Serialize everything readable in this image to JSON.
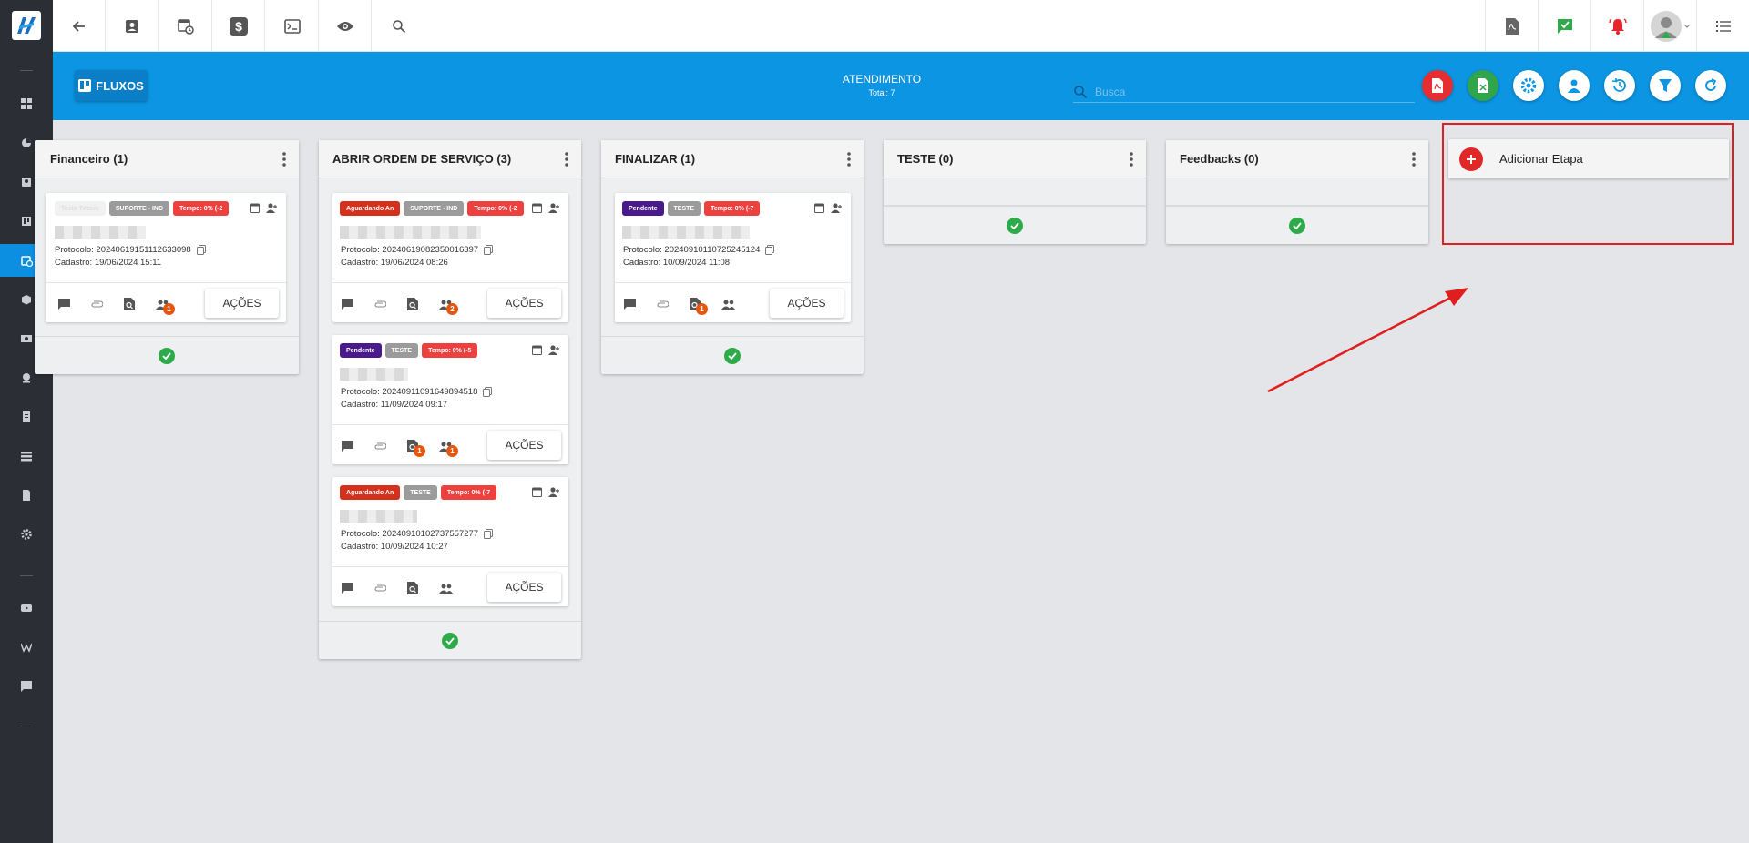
{
  "header": {
    "app_label": "FLUXOS",
    "title": "ATENDIMENTO",
    "total": "Total: 7",
    "search_placeholder": "Busca"
  },
  "colors": {
    "header_blue": "#0c95e3",
    "sidebar": "#2b2f35",
    "accent_red": "#e12828",
    "accent_green": "#2eaa4a"
  },
  "columns": [
    {
      "title": "Financeiro (1)",
      "cards": [
        {
          "tags": [
            "Teste Técnic",
            "SUPORTE - IND",
            "Tempo: 0% (-2"
          ],
          "protocol": "Protocolo: 20240619151112633098",
          "cadastro": "Cadastro: 19/06/2024 15:11",
          "badge_people": "1",
          "action": "AÇÕES"
        }
      ]
    },
    {
      "title": "ABRIR ORDEM DE SERVIÇO (3)",
      "cards": [
        {
          "tags": [
            "Aguardando An",
            "SUPORTE - IND",
            "Tempo: 0% (-2"
          ],
          "protocol": "Protocolo: 20240619082350016397",
          "cadastro": "Cadastro: 19/06/2024 08:26",
          "badge_people": "2",
          "action": "AÇÕES"
        },
        {
          "tags": [
            "Pendente",
            "TESTE",
            "Tempo: 0% (-5"
          ],
          "protocol": "Protocolo: 20240911091649894518",
          "cadastro": "Cadastro: 11/09/2024 09:17",
          "badge_doc": "1",
          "badge_people": "1",
          "action": "AÇÕES"
        },
        {
          "tags": [
            "Aguardando An",
            "TESTE",
            "Tempo: 0% (-7"
          ],
          "protocol": "Protocolo: 20240910102737557277",
          "cadastro": "Cadastro: 10/09/2024 10:27",
          "action": "AÇÕES"
        }
      ]
    },
    {
      "title": "FINALIZAR (1)",
      "cards": [
        {
          "tags": [
            "Pendente",
            "TESTE",
            "Tempo: 0% (-7"
          ],
          "protocol": "Protocolo: 20240910110725245124",
          "cadastro": "Cadastro: 10/09/2024 11:08",
          "badge_doc": "1",
          "action": "AÇÕES"
        }
      ]
    },
    {
      "title": "TESTE (0)",
      "cards": []
    },
    {
      "title": "Feedbacks (0)",
      "cards": []
    }
  ],
  "add_stage": {
    "label": "Adicionar Etapa"
  }
}
